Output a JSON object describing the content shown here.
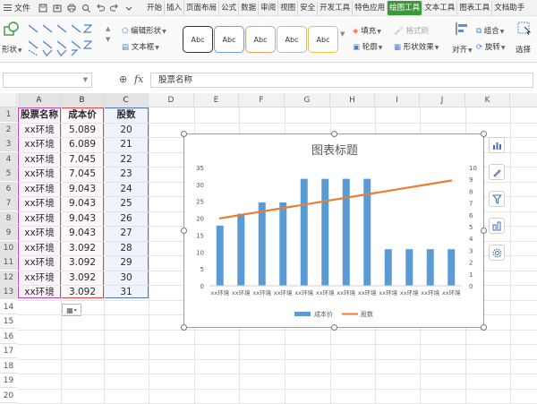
{
  "menubar": {
    "file_label": "文件",
    "tabs": [
      {
        "label": "开始",
        "active": false
      },
      {
        "label": "插入",
        "active": false
      },
      {
        "label": "页面布局",
        "active": false
      },
      {
        "label": "公式",
        "active": false
      },
      {
        "label": "数据",
        "active": false
      },
      {
        "label": "审阅",
        "active": false
      },
      {
        "label": "视图",
        "active": false
      },
      {
        "label": "安全",
        "active": false
      },
      {
        "label": "开发工具",
        "active": false
      },
      {
        "label": "特色应用",
        "active": false
      },
      {
        "label": "绘图工具",
        "active": true
      },
      {
        "label": "文本工具",
        "active": false
      },
      {
        "label": "图表工具",
        "active": false
      },
      {
        "label": "文档助手",
        "active": false
      }
    ]
  },
  "ribbon": {
    "shape_label": "形状",
    "edit_shape_label": "编辑形状",
    "textbox_label": "文本框",
    "style_sample": "Abc",
    "fill_label": "填充",
    "format_brush_label": "格式刷",
    "outline_label": "轮廓",
    "shape_effect_label": "形状效果",
    "align_label": "对齐",
    "group_label": "组合",
    "rotate_label": "旋转",
    "select_label": "选择"
  },
  "formula_bar": {
    "content": "股票名称"
  },
  "columns": [
    "A",
    "B",
    "C",
    "D",
    "E",
    "F",
    "G",
    "H",
    "I",
    "J",
    "K"
  ],
  "rows": [
    "1",
    "2",
    "3",
    "4",
    "5",
    "6",
    "7",
    "8",
    "9",
    "10",
    "11",
    "12",
    "13",
    "14",
    "15",
    "16",
    "17",
    "18",
    "19",
    "20"
  ],
  "table": {
    "headers": [
      "股票名称",
      "成本价",
      "股数"
    ],
    "rows": [
      [
        "xx环境",
        "5.089",
        "20"
      ],
      [
        "xx环境",
        "6.089",
        "21"
      ],
      [
        "xx环境",
        "7.045",
        "22"
      ],
      [
        "xx环境",
        "7.045",
        "23"
      ],
      [
        "xx环境",
        "9.043",
        "24"
      ],
      [
        "xx环境",
        "9.043",
        "25"
      ],
      [
        "xx环境",
        "9.043",
        "26"
      ],
      [
        "xx环境",
        "9.043",
        "27"
      ],
      [
        "xx环境",
        "3.092",
        "28"
      ],
      [
        "xx环境",
        "3.092",
        "29"
      ],
      [
        "xx环境",
        "3.092",
        "30"
      ],
      [
        "xx环境",
        "3.092",
        "31"
      ]
    ]
  },
  "colors": {
    "bar": "#5b9bd5",
    "line": "#ed7d31",
    "active_tab": "#3a9a3a"
  },
  "chart_data": {
    "type": "bar",
    "title": "图表标题",
    "categories": [
      "xx环境",
      "xx环境",
      "xx环境",
      "xx环境",
      "xx环境",
      "xx环境",
      "xx环境",
      "xx环境",
      "xx环境",
      "xx环境",
      "xx环境",
      "xx环境"
    ],
    "series": [
      {
        "name": "成本价",
        "type": "bar",
        "axis": "left",
        "values": [
          5.089,
          6.089,
          7.045,
          7.045,
          9.043,
          9.043,
          9.043,
          9.043,
          3.092,
          3.092,
          3.092,
          3.092
        ]
      },
      {
        "name": "股数",
        "type": "line",
        "axis": "right",
        "values": [
          20,
          21,
          22,
          23,
          24,
          25,
          26,
          27,
          28,
          29,
          30,
          31
        ]
      }
    ],
    "left_axis": {
      "min": 0,
      "max": 35,
      "step": 5,
      "ticks": [
        "0",
        "5",
        "10",
        "15",
        "20",
        "25",
        "30",
        "35"
      ]
    },
    "right_axis": {
      "min": 0,
      "max": 10,
      "step": 1,
      "ticks": [
        "0",
        "1",
        "2",
        "3",
        "4",
        "5",
        "6",
        "7",
        "8",
        "9",
        "10"
      ]
    },
    "legend_position": "bottom",
    "grid": false
  }
}
